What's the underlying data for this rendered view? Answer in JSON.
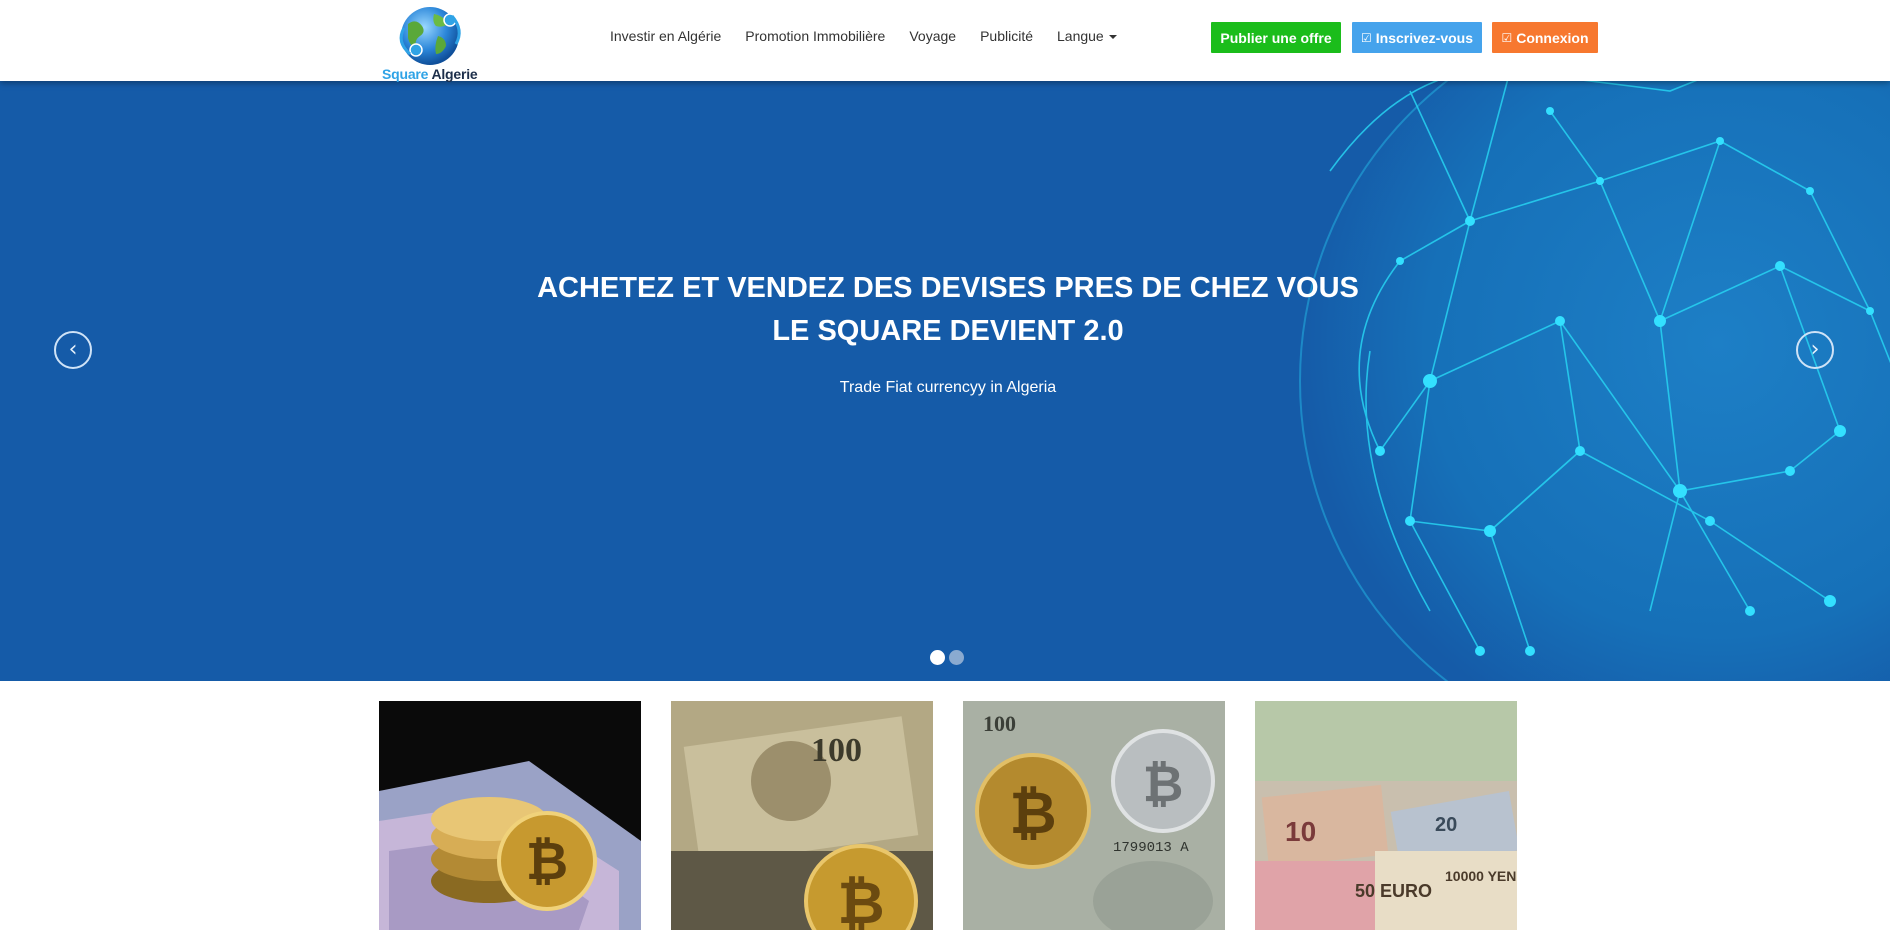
{
  "brand": {
    "logo_word1": "Square",
    "logo_word2": "Algerie"
  },
  "nav": {
    "items": [
      {
        "label": "Investir en Algérie"
      },
      {
        "label": "Promotion Immobilière"
      },
      {
        "label": "Voyage"
      },
      {
        "label": "Publicité"
      },
      {
        "label": "Langue"
      }
    ]
  },
  "actions": {
    "publish": "Publier une offre",
    "register": "Inscrivez-vous",
    "login": "Connexion"
  },
  "hero": {
    "headline_line1": "ACHETEZ ET VENDEZ DES DEVISES PRES DE CHEZ VOUS",
    "headline_line2": "LE SQUARE DEVIENT 2.0",
    "subtitle": "Trade Fiat currencyy in Algeria",
    "active_slide": 1,
    "slide_count": 2
  },
  "thumbnails": [
    {
      "icon": "bitcoin-cash-image-1"
    },
    {
      "icon": "bitcoin-dollar-image-2"
    },
    {
      "icon": "bitcoin-dollar-image-3"
    },
    {
      "icon": "banknotes-image-4"
    }
  ],
  "colors": {
    "publish": "#1bbd1b",
    "register": "#45a3ec",
    "login": "#f7782f",
    "hero_bg": "#155ba8"
  }
}
